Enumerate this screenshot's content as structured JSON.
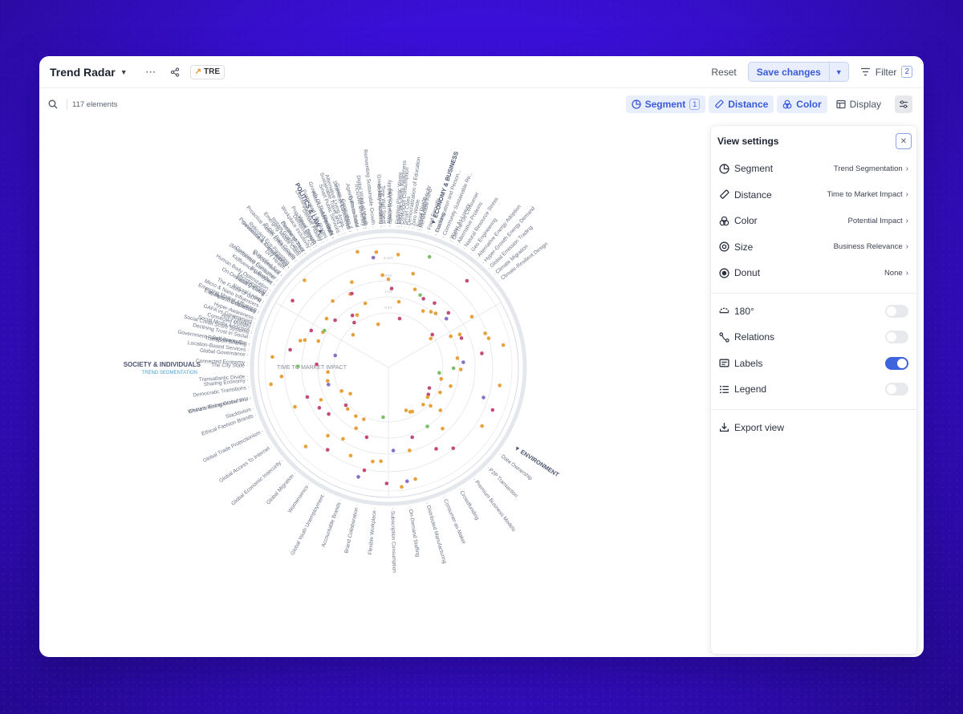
{
  "header": {
    "title": "Trend Radar",
    "badge": "TRE",
    "reset_label": "Reset",
    "save_label": "Save changes",
    "filter_label": "Filter",
    "filter_count": "2"
  },
  "toolbar": {
    "element_count": "117 elements",
    "segment_label": "Segment",
    "segment_count": "1",
    "distance_label": "Distance",
    "color_label": "Color",
    "display_label": "Display"
  },
  "radar": {
    "center_label": "TIME TO MARKET IMPACT",
    "segment_title": "SOCIETY & INDIVIDUALS",
    "segment_subtitle": "TREND SEGMENTATION",
    "sectors": [
      "ECONOMY & BUSINESS",
      "ENVIRONMENT",
      "POLITICS & LAW"
    ],
    "ring_labels": [
      "0-1Y",
      "1-3Y",
      "3-5Y",
      "5-10Y"
    ],
    "colors": {
      "orange": "#e6a13a",
      "magenta": "#c44a7a",
      "green": "#7cbf6a",
      "purple": "#8a6fc7"
    },
    "labels": [
      "Identity Pluralism",
      "Space Scarcity",
      "Body-Inclusivity Awareness",
      "Democratization of Education",
      "Social Divide",
      "Location-Based Services",
      "Self-Promotion",
      "Declining Trust in Social",
      "Social Media Addiction",
      "Anti-Pollution",
      "Hyper-Awareness",
      "In-Person Connection",
      "Micro & Nano Influencers",
      "Natural Living",
      "Healthy Living",
      "Human Body Optimization",
      "Kidfluence Lifestyles",
      "Conscious Consumer",
      "Quantified Self",
      "DIY Health",
      "Ridiculed Eco-Parenting",
      "Proactive Health Enforcement",
      "Emerging Middle Class",
      "Postdemocracy",
      "Workplace Inclusivity",
      "Population Growth",
      "Gender Fluidity",
      "Postponed Life Stages",
      "Millennials",
      "Smart Public Services",
      "Alternative Living Arran...",
      "Generation Z",
      "Ageing Reinvented",
      "Inclusive Diversity",
      "Slacktivism",
      "China's Rising Global In...",
      "Democratic Transitions",
      "Transatlantic Divide",
      "The City State",
      "Global Governance",
      "Government Response to C...",
      "Social Credit Score Systems",
      "GAFA vs Government",
      "Employer Transparency",
      "The Future of GDPR",
      "Microtargeting",
      "Big Brother",
      "E-Governance",
      "Government Accountability",
      "Public Data Growth",
      "Decline of Trust",
      "Democracy 2.0",
      "Disintegration of the EU",
      "Growth Of The Far Right",
      "Sustainable Travel and T...",
      "Green Supply Chain",
      "Farm to Table",
      "Mega Cities",
      "Reinventing Sustainable Growth",
      "Green Manufacturing",
      "Alternative Mobility",
      "Fighting Plastic Waste",
      "Smart Cities",
      "Zero Waste",
      "Renewable Fund",
      "Food Security",
      "Fracking",
      "Community Sustainable Re...",
      "Water As Luxury",
      "Alternative Proteins",
      "Natural Resource Stress",
      "Geo Engineering",
      "Alternative Energy Adoption",
      "Hyper-Growth Energy Demand",
      "Global Emission Trading",
      "Climate Migration",
      "Climate-Resilient Design",
      "Data Ownership",
      "P2P Transaction",
      "Premium Business Models",
      "Crowdfunding",
      "Consumer-as-Maker",
      "Distributed Manufacturing",
      "On-Demand Staffing",
      "Subscription Consumption",
      "Flexible Workplace",
      "Brand Collaboration",
      "Accountable Brands",
      "Global Youth Unemployment",
      "Womenomics",
      "Global Migration",
      "Global Economic Insecurity",
      "Global Access To Internet",
      "Global Trade Protectionism",
      "Ethical Fashion Brands",
      "Western Entrepreneurship",
      "Sharing Economy",
      "Connected Economy",
      "Transport Sharing",
      "Connected Mobility",
      "Emerging Market Affluence",
      "On-Demand Delivery",
      "(Ms)informed Consumer",
      "Provenance & Transparency",
      "Instant Gratification",
      "Visual Search",
      "Autonomous Brands",
      "Seamless Commerce",
      "Digital Word of Mouth",
      "Time Well Spent",
      "Conscious Consumption",
      "Brand Authenticity",
      "Customization and Person...",
      "On-The-Go Consumer",
      "Retail Singularity",
      "Influencer Marketing"
    ]
  },
  "view_settings": {
    "title": "View settings",
    "rows": [
      {
        "label": "Segment",
        "value": "Trend Segmentation"
      },
      {
        "label": "Distance",
        "value": "Time to Market Impact"
      },
      {
        "label": "Color",
        "value": "Potential Impact"
      },
      {
        "label": "Size",
        "value": "Business Relevance"
      },
      {
        "label": "Donut",
        "value": "None"
      }
    ],
    "toggles": [
      {
        "label": "180°",
        "on": false
      },
      {
        "label": "Relations",
        "on": false
      },
      {
        "label": "Labels",
        "on": true
      },
      {
        "label": "Legend",
        "on": false
      }
    ],
    "export_label": "Export view"
  }
}
